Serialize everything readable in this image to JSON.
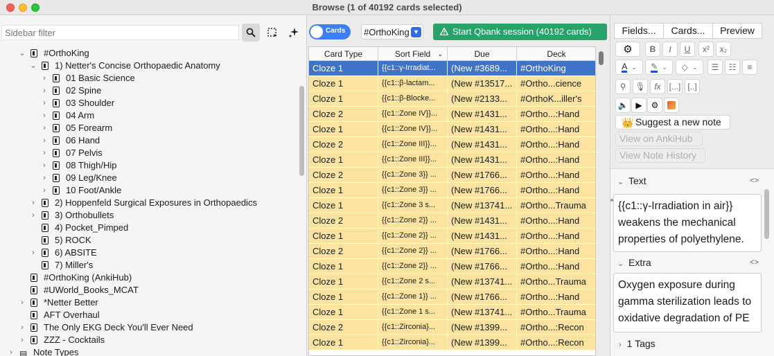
{
  "window": {
    "title": "Browse (1 of 40192 cards selected)"
  },
  "sidebar": {
    "filter_placeholder": "Sidebar filter",
    "tree": [
      {
        "label": "#OrthoKing",
        "level": 0,
        "chev": "down",
        "deck": true
      },
      {
        "label": "1) Netter's Concise Orthopaedic Anatomy",
        "level": 1,
        "chev": "down",
        "deck": true
      },
      {
        "label": "01 Basic Science",
        "level": 2,
        "chev": "right",
        "deck": true
      },
      {
        "label": "02 Spine",
        "level": 2,
        "chev": "right",
        "deck": true
      },
      {
        "label": "03 Shoulder",
        "level": 2,
        "chev": "right",
        "deck": true
      },
      {
        "label": "04 Arm",
        "level": 2,
        "chev": "right",
        "deck": true
      },
      {
        "label": "05 Forearm",
        "level": 2,
        "chev": "right",
        "deck": true
      },
      {
        "label": "06 Hand",
        "level": 2,
        "chev": "right",
        "deck": true
      },
      {
        "label": "07 Pelvis",
        "level": 2,
        "chev": "right",
        "deck": true
      },
      {
        "label": "08 Thigh/Hip",
        "level": 2,
        "chev": "right",
        "deck": true
      },
      {
        "label": "09 Leg/Knee",
        "level": 2,
        "chev": "right",
        "deck": true
      },
      {
        "label": "10 Foot/Ankle",
        "level": 2,
        "chev": "right",
        "deck": true
      },
      {
        "label": "2) Hoppenfeld Surgical Exposures in Orthopaedics",
        "level": 1,
        "chev": "right",
        "deck": true
      },
      {
        "label": "3) Orthobullets",
        "level": 1,
        "chev": "right",
        "deck": true
      },
      {
        "label": "4) Pocket_Pimped",
        "level": 1,
        "chev": "",
        "deck": true
      },
      {
        "label": "5) ROCK",
        "level": 1,
        "chev": "",
        "deck": true
      },
      {
        "label": "6) ABSITE",
        "level": 1,
        "chev": "right",
        "deck": true
      },
      {
        "label": "7) Miller's",
        "level": 1,
        "chev": "",
        "deck": true
      },
      {
        "label": "#OrthoKing (AnkiHub)",
        "level": 0,
        "chev": "",
        "deck": true
      },
      {
        "label": "#UWorld_Books_MCAT",
        "level": 0,
        "chev": "",
        "deck": true
      },
      {
        "label": "*Netter Better",
        "level": 0,
        "chev": "right",
        "deck": true
      },
      {
        "label": "AFT Overhaul",
        "level": 0,
        "chev": "",
        "deck": true
      },
      {
        "label": "The Only EKG Deck You'll Ever Need",
        "level": 0,
        "chev": "right",
        "deck": true
      },
      {
        "label": "ZZZ - Cocktails",
        "level": 0,
        "chev": "right",
        "deck": true
      },
      {
        "label": "Note Types",
        "level": -1,
        "chev": "right",
        "deck": false
      }
    ]
  },
  "toolbar": {
    "toggle_label": "Cards",
    "deck_select": "#OrthoKing",
    "qbank_label": "Start Qbank session (40192 cards)"
  },
  "table": {
    "columns": [
      "Card Type",
      "Sort Field",
      "Due",
      "Deck"
    ],
    "rows": [
      {
        "type": "Cloze 1",
        "sort": "{{c1::γ-Irradiat...",
        "due": "(New #3689...",
        "deck": "#OrthoKing",
        "selected": true
      },
      {
        "type": "Cloze 1",
        "sort": "{{c1::β-lactam...",
        "due": "(New #13517...",
        "deck": "#Ortho...cience"
      },
      {
        "type": "Cloze 1",
        "sort": "{{c1::β-Blocke...",
        "due": "(New #2133...",
        "deck": "#OrthoK...iller's"
      },
      {
        "type": "Cloze 2",
        "sort": "{{c1::Zone IV}}...",
        "due": "(New #1431...",
        "deck": "#Ortho...:Hand"
      },
      {
        "type": "Cloze 1",
        "sort": "{{c1::Zone IV}}...",
        "due": "(New #1431...",
        "deck": "#Ortho...:Hand"
      },
      {
        "type": "Cloze 2",
        "sort": "{{c1::Zone III}}...",
        "due": "(New #1431...",
        "deck": "#Ortho...:Hand"
      },
      {
        "type": "Cloze 1",
        "sort": "{{c1::Zone III}}...",
        "due": "(New #1431...",
        "deck": "#Ortho...:Hand"
      },
      {
        "type": "Cloze 2",
        "sort": "{{c1::Zone 3}} ...",
        "due": "(New #1766...",
        "deck": "#Ortho...:Hand"
      },
      {
        "type": "Cloze 1",
        "sort": "{{c1::Zone 3}} ...",
        "due": "(New #1766...",
        "deck": "#Ortho...:Hand"
      },
      {
        "type": "Cloze 1",
        "sort": "{{c1::Zone 3 s...",
        "due": "(New #13741...",
        "deck": "#Ortho...Trauma"
      },
      {
        "type": "Cloze 2",
        "sort": "{{c1::Zone 2}} ...",
        "due": "(New #1431...",
        "deck": "#Ortho...:Hand"
      },
      {
        "type": "Cloze 1",
        "sort": "{{c1::Zone 2}} ...",
        "due": "(New #1431...",
        "deck": "#Ortho...:Hand"
      },
      {
        "type": "Cloze 2",
        "sort": "{{c1::Zone 2}} ...",
        "due": "(New #1766...",
        "deck": "#Ortho...:Hand"
      },
      {
        "type": "Cloze 1",
        "sort": "{{c1::Zone 2}} ...",
        "due": "(New #1766...",
        "deck": "#Ortho...:Hand"
      },
      {
        "type": "Cloze 1",
        "sort": "{{c1::Zone 2 s...",
        "due": "(New #13741...",
        "deck": "#Ortho...Trauma"
      },
      {
        "type": "Cloze 1",
        "sort": "{{c1::Zone 1}} ...",
        "due": "(New #1766...",
        "deck": "#Ortho...:Hand"
      },
      {
        "type": "Cloze 1",
        "sort": "{{c1::Zone 1 s...",
        "due": "(New #13741...",
        "deck": "#Ortho...Trauma"
      },
      {
        "type": "Cloze 2",
        "sort": "{{c1::Zirconia}...",
        "due": "(New #1399...",
        "deck": "#Ortho...:Recon"
      },
      {
        "type": "Cloze 1",
        "sort": "{{c1::Zirconia}...",
        "due": "(New #1399...",
        "deck": "#Ortho...:Recon"
      }
    ]
  },
  "editor": {
    "tabs": [
      "Fields...",
      "Cards...",
      "Preview"
    ],
    "format_buttons": [
      "B",
      "I",
      "U",
      "x²",
      "x₂"
    ],
    "suggest_label": "Suggest a new note",
    "view_ankihub": "View on AnkiHub",
    "view_history": "View Note History",
    "fields": [
      {
        "name": "Text",
        "content": "{{c1::γ-Irradiation in air}} weakens the mechanical properties of polyethylene."
      },
      {
        "name": "Extra",
        "content": "Oxygen exposure during gamma sterilization leads to oxidative degradation of PE"
      }
    ],
    "code_toggle": "<>",
    "tags_label": "1 Tags"
  },
  "colors": {
    "row_bg": "#fce4a0",
    "row_selected": "#3f73c7",
    "qbank": "#27a36a",
    "toggle": "#3b7ef6"
  }
}
